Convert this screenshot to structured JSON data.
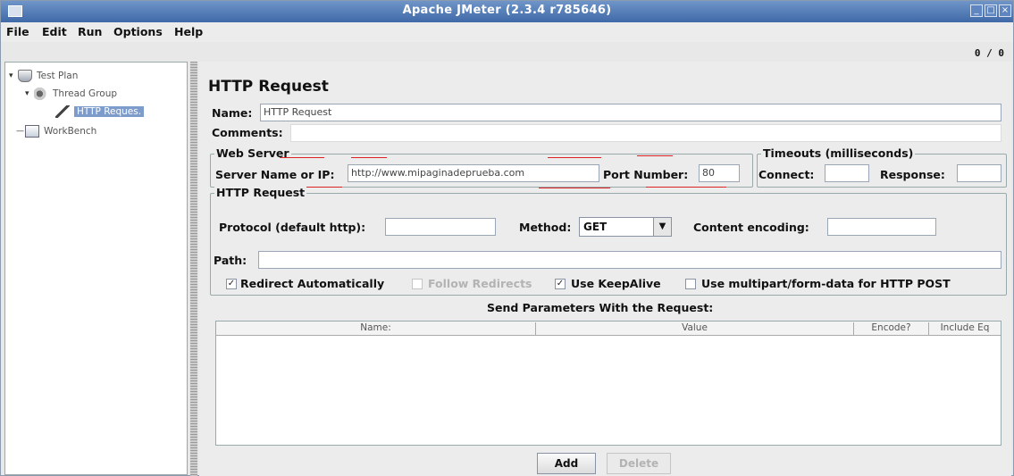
{
  "window": {
    "title": "Apache JMeter (2.3.4 r785646)",
    "min_icon": "minimize-icon",
    "max_icon": "maximize-icon",
    "close_icon": "close-icon"
  },
  "menu": [
    "File",
    "Edit",
    "Run",
    "Options",
    "Help"
  ],
  "counter": "0 / 0",
  "tree": [
    {
      "label": "Test Plan",
      "icon": "flask-icon"
    },
    {
      "label": "Thread Group",
      "icon": "gears-icon"
    },
    {
      "label": "HTTP Reques.",
      "icon": "pipette-icon",
      "selected": true
    },
    {
      "label": "WorkBench",
      "icon": "workbench-icon"
    }
  ],
  "panel": {
    "title": "HTTP Request",
    "name_label": "Name:",
    "name_value": "HTTP Request",
    "comments_label": "Comments:",
    "web_server": {
      "legend": "Web Server",
      "server_label": "Server Name or IP:",
      "server_value": "http://www.mipaginadeprueba.com",
      "port_label": "Port Number:",
      "port_value": "80"
    },
    "timeouts": {
      "legend": "Timeouts (milliseconds)",
      "connect_label": "Connect:",
      "response_label": "Response:"
    },
    "http_request": {
      "legend": "HTTP Request",
      "protocol_label": "Protocol (default http):",
      "method_label": "Method:",
      "method_value": "GET",
      "encoding_label": "Content encoding:",
      "path_label": "Path:"
    },
    "options": [
      {
        "label": "Redirect Automatically",
        "checked": true,
        "enabled": true
      },
      {
        "label": "Follow Redirects",
        "checked": false,
        "enabled": false
      },
      {
        "label": "Use KeepAlive",
        "checked": true,
        "enabled": true
      },
      {
        "label": "Use multipart/form-data for HTTP POST",
        "checked": false,
        "enabled": true
      }
    ],
    "params_title": "Send Parameters With the Request:",
    "columns": [
      "Name:",
      "Value",
      "Encode?",
      "Include Eq"
    ],
    "add_label": "Add",
    "delete_label": "Delete"
  }
}
